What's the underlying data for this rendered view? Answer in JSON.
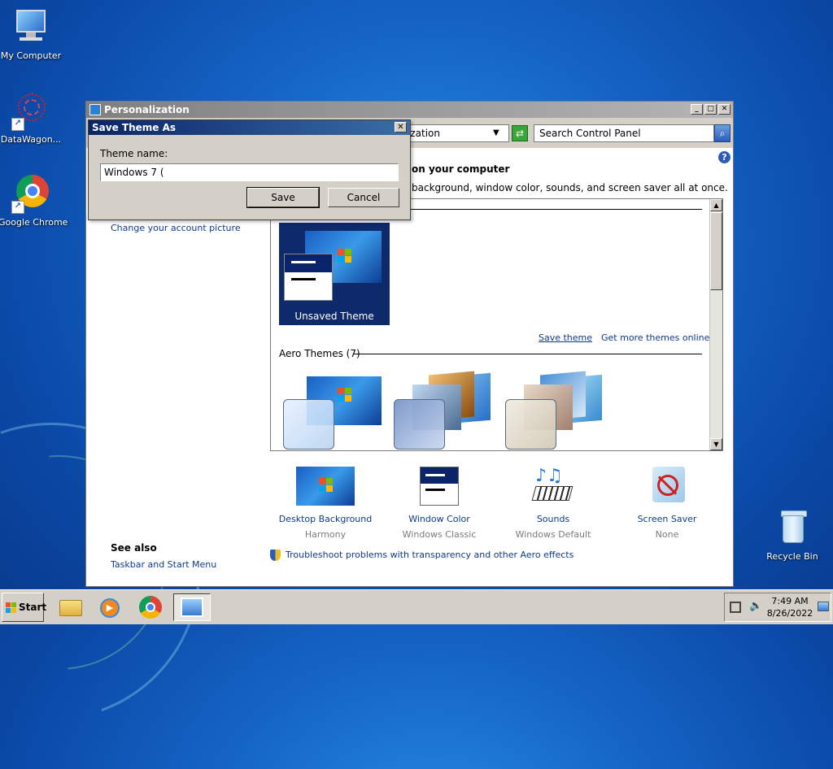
{
  "desktop": {
    "icons": [
      {
        "label": "My Computer"
      },
      {
        "label": "DataWagon..."
      },
      {
        "label": "Google Chrome"
      },
      {
        "label": "Recycle Bin"
      }
    ]
  },
  "window": {
    "title": "Personalization",
    "address": "ization",
    "search_placeholder": "Search Control Panel",
    "heading": "on your computer",
    "subheading": "background, window color, sounds, and screen saver all at once.",
    "left_links": [
      "Change your account picture"
    ],
    "see_also": {
      "title": "See also",
      "links": [
        "Taskbar and Start Menu"
      ]
    },
    "my_themes": {
      "unsaved_label": "Unsaved Theme",
      "save_theme": "Save theme",
      "get_more": "Get more themes online"
    },
    "aero_themes_label": "Aero Themes (7)",
    "bottom": [
      {
        "title": "Desktop Background",
        "sub": "Harmony"
      },
      {
        "title": "Window Color",
        "sub": "Windows Classic"
      },
      {
        "title": "Sounds",
        "sub": "Windows Default"
      },
      {
        "title": "Screen Saver",
        "sub": "None"
      }
    ],
    "troubleshoot": "Troubleshoot problems with transparency and other Aero effects"
  },
  "dialog": {
    "title": "Save Theme As",
    "close": "✕",
    "label": "Theme name:",
    "value": "Windows 7 (",
    "save": "Save",
    "cancel": "Cancel"
  },
  "taskbar": {
    "start": "Start",
    "time": "7:49 AM",
    "date": "8/26/2022"
  },
  "colors": {
    "link": "#0d3b8c",
    "dialog_title": "#0a246a",
    "classic_face": "#d4d0c8"
  }
}
